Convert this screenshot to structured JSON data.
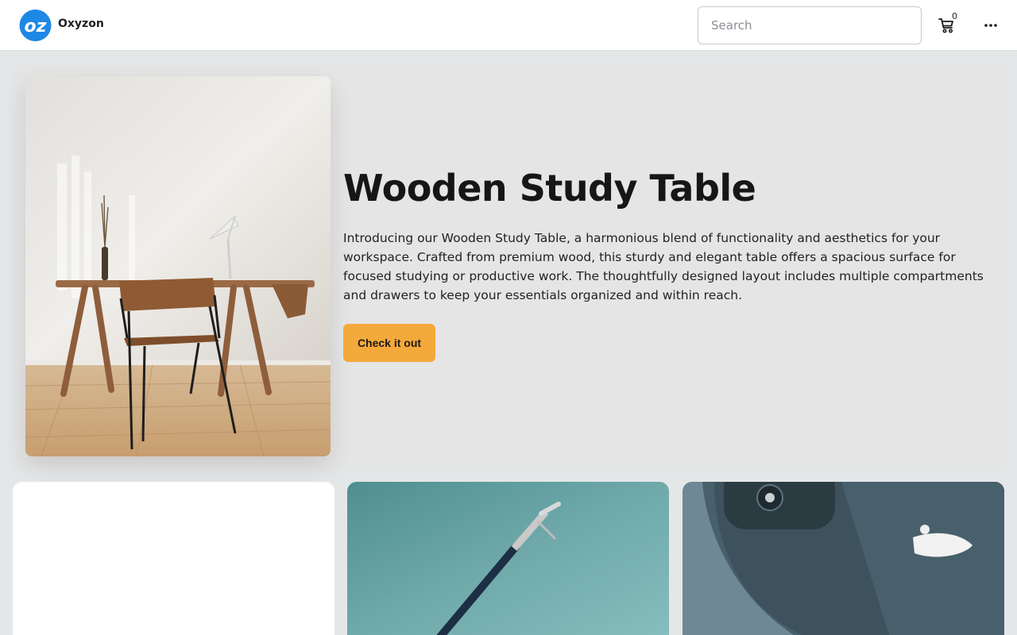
{
  "header": {
    "brand_name": "Oxyzon",
    "logo_text": "oz",
    "search_placeholder": "Search",
    "cart_count": "0",
    "cart_icon": "cart-icon",
    "more_icon": "more-horizontal-icon"
  },
  "hero": {
    "title": "Wooden Study Table",
    "description": "Introducing our Wooden Study Table, a harmonious blend of functionality and aesthetics for your workspace. Crafted from premium wood, this sturdy and elegant table offers a spacious surface for focused studying or productive work. The thoughtfully designed layout includes multiple compartments and drawers to keep your essentials organized and within reach.",
    "cta_label": "Check it out"
  },
  "colors": {
    "accent": "#f4a93b",
    "logo_blue": "#1e88e5",
    "page_bg": "#e4e7e8"
  }
}
